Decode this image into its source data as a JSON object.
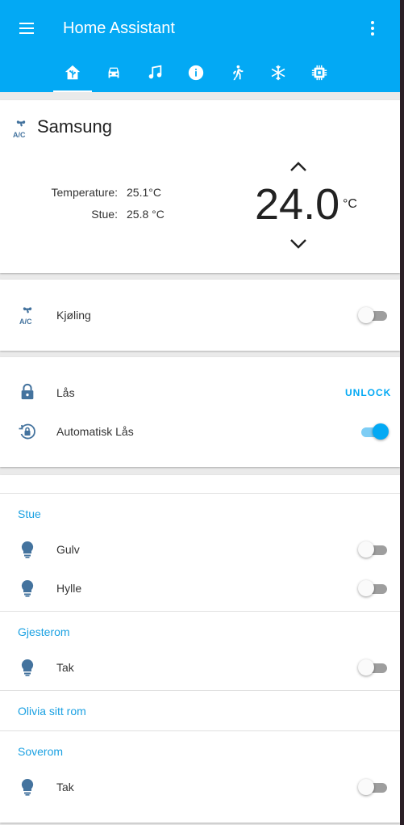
{
  "header": {
    "title": "Home Assistant",
    "tabs": [
      {
        "icon": "home-assistant-icon",
        "active": true
      },
      {
        "icon": "car-icon"
      },
      {
        "icon": "music-note-icon"
      },
      {
        "icon": "info-icon"
      },
      {
        "icon": "walk-icon"
      },
      {
        "icon": "snowflake-icon"
      },
      {
        "icon": "chip-icon"
      }
    ]
  },
  "climate": {
    "name": "Samsung",
    "icon": "air-conditioner-icon",
    "temperature_label": "Temperature:",
    "temperature_value": "25.1°C",
    "stue_label": "Stue:",
    "stue_value": "25.8 °C",
    "target": "24.0",
    "target_unit": "°C"
  },
  "cooling": {
    "label": "Kjøling",
    "icon": "air-conditioner-icon",
    "state": false
  },
  "lock": {
    "label": "Lås",
    "icon": "lock-icon",
    "action": "UNLOCK",
    "auto_label": "Automatisk Lås",
    "auto_icon": "lock-reset-icon",
    "auto_state": true
  },
  "groups": [
    {
      "title": "Stue",
      "items": [
        {
          "label": "Gulv",
          "state": false
        },
        {
          "label": "Hylle",
          "state": false
        }
      ]
    },
    {
      "title": "Gjesterom",
      "items": [
        {
          "label": "Tak",
          "state": false
        }
      ]
    },
    {
      "title": "Olivia sitt rom",
      "items": []
    },
    {
      "title": "Soverom",
      "items": [
        {
          "label": "Tak",
          "state": false
        }
      ]
    }
  ],
  "colors": {
    "primary": "#03a9f4",
    "icon": "#44739e",
    "section": "#1ba1e2"
  }
}
